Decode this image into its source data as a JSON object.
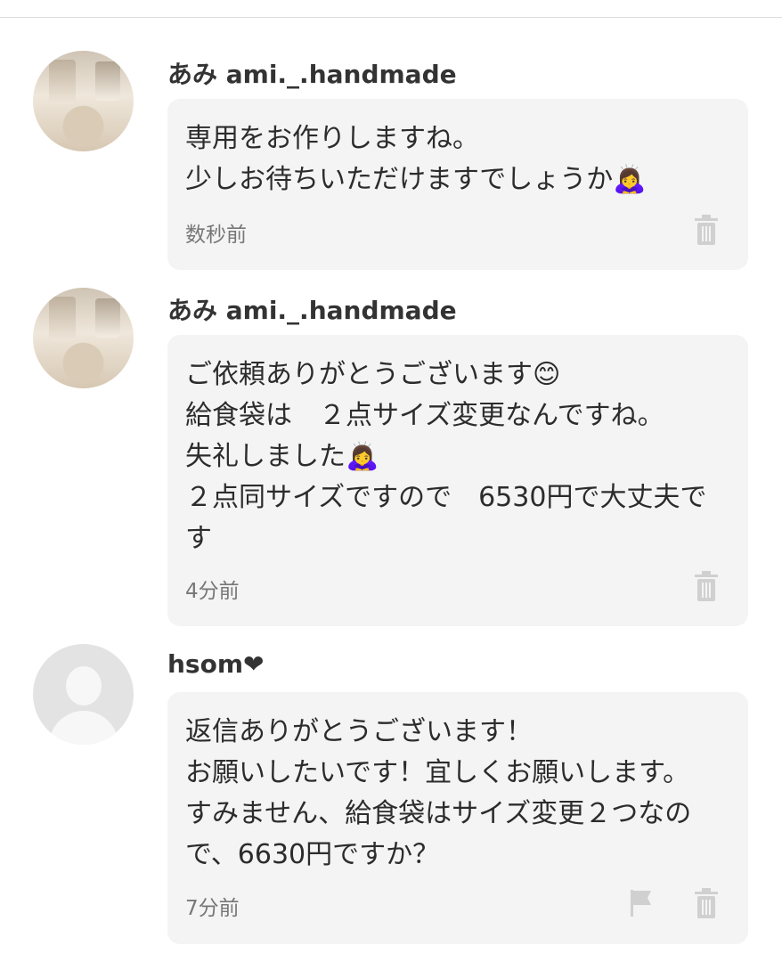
{
  "messages": [
    {
      "author": "あみ  ami._.handmade",
      "text": "専用をお作りしますね。\n少しお待ちいただけますでしょうか🙇‍♀️",
      "time": "数秒前"
    },
    {
      "author": "あみ  ami._.handmade",
      "text": "ご依頼ありがとうございます😊\n給食袋は　２点サイズ変更なんですね。\n失礼しました🙇‍♀️\n２点同サイズですので　6530円で大丈夫です",
      "time": "4分前"
    },
    {
      "author": "hsom",
      "author_suffix": "❤",
      "text": "返信ありがとうございます！\nお願いしたいです！宜しくお願いします。\nすみません、給食袋はサイズ変更２つなので、6630円ですか？",
      "time": "7分前"
    }
  ],
  "icons": {
    "delete": "trash-icon",
    "report": "flag-icon",
    "default_avatar": "user-silhouette-icon"
  },
  "colors": {
    "bubble": "#f4f4f4",
    "icon": "#d0d0d0",
    "time": "#777777"
  }
}
